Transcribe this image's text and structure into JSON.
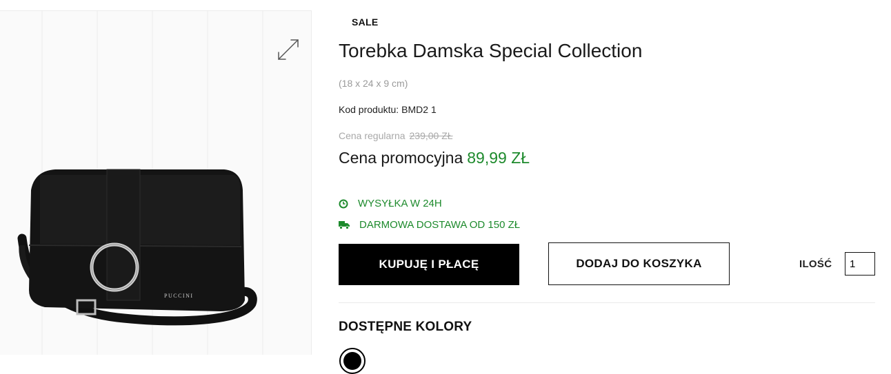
{
  "product": {
    "sale_label": "SALE",
    "title": "Torebka Damska Special Collection",
    "dimensions": "(18 x 24 x 9 cm)",
    "code_label": "Kod produktu:",
    "code_value": "BMD2 1",
    "regular_price_label": "Cena regularna",
    "regular_price": "239,00 ZŁ",
    "promo_price_label": "Cena promocyjna",
    "promo_price": "89,99 ZŁ",
    "bag_brand": "PUCCINI"
  },
  "shipping": {
    "dispatch": "WYSYŁKA W 24H",
    "free_delivery": "DARMOWA DOSTAWA OD 150 ZŁ",
    "dispatch_icon": "clock-icon",
    "delivery_icon": "truck-icon"
  },
  "actions": {
    "buy_now_label": "KUPUJĘ I PŁACĘ",
    "add_to_cart_label": "DODAJ DO KOSZYKA",
    "quantity_label": "ILOŚĆ",
    "quantity_value": "1"
  },
  "colors": {
    "title": "DOSTĘPNE KOLORY",
    "options": [
      "black"
    ]
  },
  "theme": {
    "accent_green": "#1d8a2c",
    "sale_red": "#e3121f",
    "primary_button": "#000000"
  }
}
